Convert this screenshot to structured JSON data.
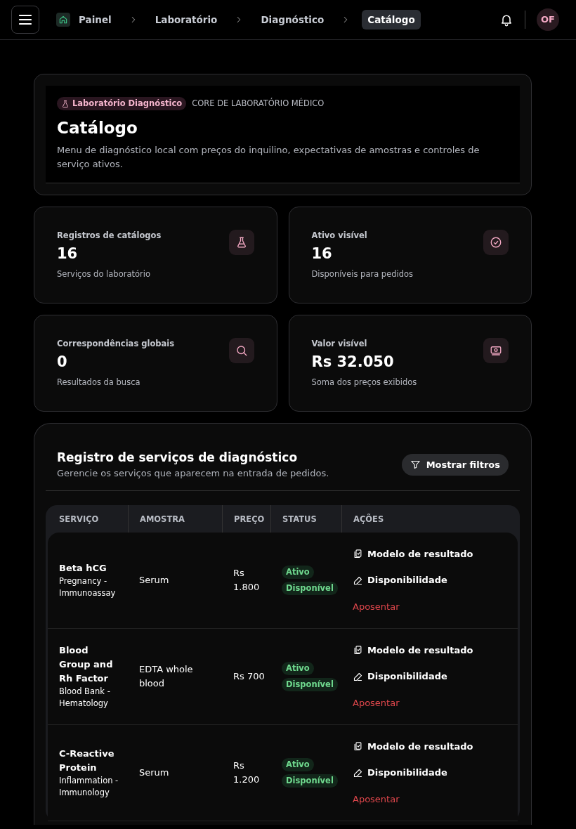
{
  "topbar": {
    "breadcrumbs": [
      {
        "label": "Painel",
        "home": true,
        "selected": false
      },
      {
        "label": "Laboratório",
        "home": false,
        "selected": false
      },
      {
        "label": "Diagnóstico",
        "home": false,
        "selected": false
      },
      {
        "label": "Catálogo",
        "home": false,
        "selected": true
      }
    ],
    "avatar": "OF"
  },
  "hero": {
    "badge": "Laboratório Diagnóstico",
    "eyebrow": "CORE DE LABORATÓRIO MÉDICO",
    "title": "Catálogo",
    "description": "Menu de diagnóstico local com preços do inquilino, expectativas de amostras e controles de serviço ativos."
  },
  "stats": [
    {
      "label": "Registros de catálogos",
      "value": "16",
      "caption": "Serviços do laboratório"
    },
    {
      "label": "Ativo visível",
      "value": "16",
      "caption": "Disponíveis para pedidos"
    },
    {
      "label": "Correspondências globais",
      "value": "0",
      "caption": "Resultados da busca"
    },
    {
      "label": "Valor visível",
      "value": "Rs 32.050",
      "caption": "Soma dos preços exibidos"
    }
  ],
  "registry": {
    "title": "Registro de serviços de diagnóstico",
    "subtitle": "Gerencie os serviços que aparecem na entrada de pedidos.",
    "filter_button": "Mostrar filtros",
    "table": {
      "columns": [
        "SERVIÇO",
        "AMOSTRA",
        "PREÇO",
        "STATUS",
        "AÇÕES"
      ],
      "rows": [
        {
          "service": "Beta hCG",
          "category": "Pregnancy - Immunoassay",
          "sample": "Serum",
          "price": "Rs 1.800",
          "statuses": [
            "Ativo",
            "Disponível"
          ],
          "actions": [
            "Modelo de resultado",
            "Disponibilidade"
          ],
          "retire": "Aposentar"
        },
        {
          "service": "Blood Group and Rh Factor",
          "category": "Blood Bank - Hematology",
          "sample": "EDTA whole blood",
          "price": "Rs 700",
          "statuses": [
            "Ativo",
            "Disponível"
          ],
          "actions": [
            "Modelo de resultado",
            "Disponibilidade"
          ],
          "retire": "Aposentar"
        },
        {
          "service": "C-Reactive Protein",
          "category": "Inflammation - Immunology",
          "sample": "Serum",
          "price": "Rs 1.200",
          "statuses": [
            "Ativo",
            "Disponível"
          ],
          "actions": [
            "Modelo de resultado",
            "Disponibilidade"
          ],
          "retire": "Aposentar"
        }
      ]
    }
  }
}
